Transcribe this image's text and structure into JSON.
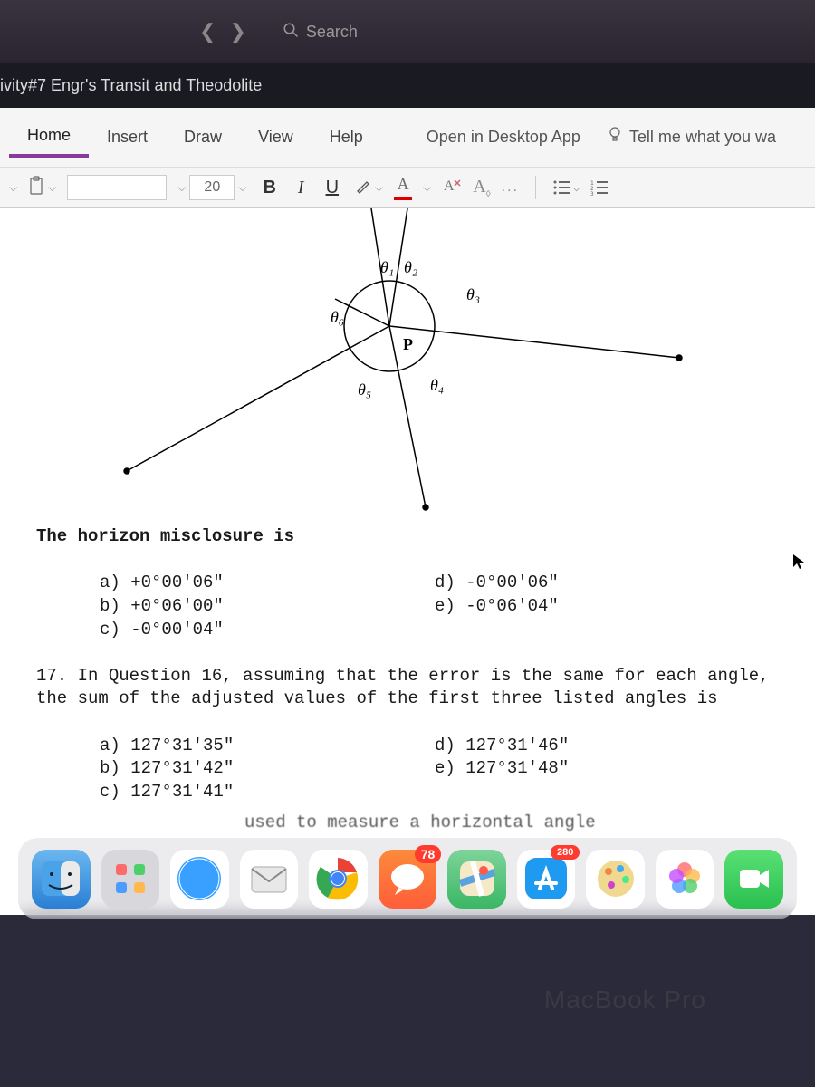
{
  "menubar": {
    "search_placeholder": "Search"
  },
  "window": {
    "title": "ivity#7 Engr's Transit and Theodolite"
  },
  "tabs": {
    "home": "Home",
    "insert": "Insert",
    "draw": "Draw",
    "view": "View",
    "help": "Help",
    "desktop_app": "Open in Desktop App",
    "tell_me": "Tell me what you wa"
  },
  "toolbar": {
    "font_size": "20",
    "bold": "B",
    "italic": "I",
    "underline": "U",
    "font_color_letter": "A",
    "clear_fmt": "A",
    "more": "..."
  },
  "diagram": {
    "labels": {
      "l1": "θ₁",
      "l2": "θ₂",
      "l3": "θ₃",
      "l4": "θ₄",
      "l5": "θ₅",
      "l6": "θ₆",
      "lp": "P"
    }
  },
  "document": {
    "q_misclosure": "The horizon misclosure is",
    "q16_options_left": {
      "a": "a) +0°00'06\"",
      "b": "b) +0°06'00\"",
      "c": "c) -0°00'04\""
    },
    "q16_options_right": {
      "d": "d) -0°00'06\"",
      "e": "e) -0°06'04\""
    },
    "q17_num": "17.",
    "q17_text": "In Question 16,  assuming that the error is  the  same for each angle, the sum of the adjusted values of the first three listed angles is",
    "q17_options_left": {
      "a": "a) 127°31'35\"",
      "b": "b) 127°31'42\"",
      "c": "c) 127°31'41\""
    },
    "q17_options_right": {
      "d": "d) 127°31'46\"",
      "e": "e) 127°31'48\""
    },
    "partial_bottom": "used to measure a horizontal angle"
  },
  "dock": {
    "finder": "finder",
    "launchpad": "launchpad",
    "safari": "safari",
    "mail": "mail",
    "chrome": "chrome",
    "messages": "messages",
    "maps": "maps",
    "badge1": "78",
    "badge2": "280",
    "paint": "paint",
    "photos": "photos",
    "facetime": "facetime"
  },
  "laptop": "MacBook Pro"
}
